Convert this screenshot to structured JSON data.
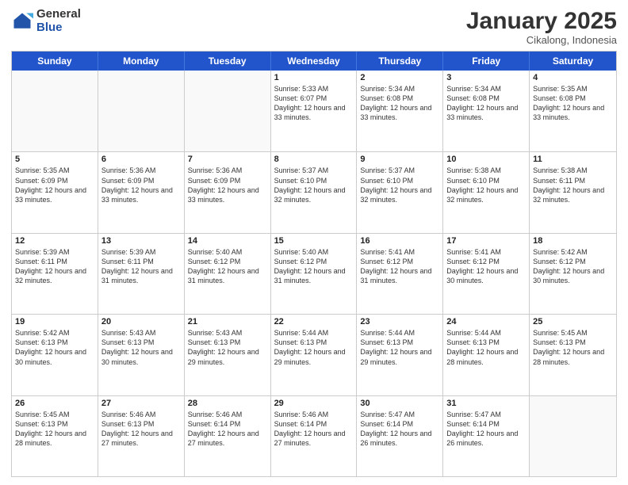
{
  "logo": {
    "general": "General",
    "blue": "Blue"
  },
  "title": {
    "month": "January 2025",
    "location": "Cikalong, Indonesia"
  },
  "header_days": [
    "Sunday",
    "Monday",
    "Tuesday",
    "Wednesday",
    "Thursday",
    "Friday",
    "Saturday"
  ],
  "weeks": [
    [
      {
        "day": "",
        "info": ""
      },
      {
        "day": "",
        "info": ""
      },
      {
        "day": "",
        "info": ""
      },
      {
        "day": "1",
        "info": "Sunrise: 5:33 AM\nSunset: 6:07 PM\nDaylight: 12 hours and 33 minutes."
      },
      {
        "day": "2",
        "info": "Sunrise: 5:34 AM\nSunset: 6:08 PM\nDaylight: 12 hours and 33 minutes."
      },
      {
        "day": "3",
        "info": "Sunrise: 5:34 AM\nSunset: 6:08 PM\nDaylight: 12 hours and 33 minutes."
      },
      {
        "day": "4",
        "info": "Sunrise: 5:35 AM\nSunset: 6:08 PM\nDaylight: 12 hours and 33 minutes."
      }
    ],
    [
      {
        "day": "5",
        "info": "Sunrise: 5:35 AM\nSunset: 6:09 PM\nDaylight: 12 hours and 33 minutes."
      },
      {
        "day": "6",
        "info": "Sunrise: 5:36 AM\nSunset: 6:09 PM\nDaylight: 12 hours and 33 minutes."
      },
      {
        "day": "7",
        "info": "Sunrise: 5:36 AM\nSunset: 6:09 PM\nDaylight: 12 hours and 33 minutes."
      },
      {
        "day": "8",
        "info": "Sunrise: 5:37 AM\nSunset: 6:10 PM\nDaylight: 12 hours and 32 minutes."
      },
      {
        "day": "9",
        "info": "Sunrise: 5:37 AM\nSunset: 6:10 PM\nDaylight: 12 hours and 32 minutes."
      },
      {
        "day": "10",
        "info": "Sunrise: 5:38 AM\nSunset: 6:10 PM\nDaylight: 12 hours and 32 minutes."
      },
      {
        "day": "11",
        "info": "Sunrise: 5:38 AM\nSunset: 6:11 PM\nDaylight: 12 hours and 32 minutes."
      }
    ],
    [
      {
        "day": "12",
        "info": "Sunrise: 5:39 AM\nSunset: 6:11 PM\nDaylight: 12 hours and 32 minutes."
      },
      {
        "day": "13",
        "info": "Sunrise: 5:39 AM\nSunset: 6:11 PM\nDaylight: 12 hours and 31 minutes."
      },
      {
        "day": "14",
        "info": "Sunrise: 5:40 AM\nSunset: 6:12 PM\nDaylight: 12 hours and 31 minutes."
      },
      {
        "day": "15",
        "info": "Sunrise: 5:40 AM\nSunset: 6:12 PM\nDaylight: 12 hours and 31 minutes."
      },
      {
        "day": "16",
        "info": "Sunrise: 5:41 AM\nSunset: 6:12 PM\nDaylight: 12 hours and 31 minutes."
      },
      {
        "day": "17",
        "info": "Sunrise: 5:41 AM\nSunset: 6:12 PM\nDaylight: 12 hours and 30 minutes."
      },
      {
        "day": "18",
        "info": "Sunrise: 5:42 AM\nSunset: 6:12 PM\nDaylight: 12 hours and 30 minutes."
      }
    ],
    [
      {
        "day": "19",
        "info": "Sunrise: 5:42 AM\nSunset: 6:13 PM\nDaylight: 12 hours and 30 minutes."
      },
      {
        "day": "20",
        "info": "Sunrise: 5:43 AM\nSunset: 6:13 PM\nDaylight: 12 hours and 30 minutes."
      },
      {
        "day": "21",
        "info": "Sunrise: 5:43 AM\nSunset: 6:13 PM\nDaylight: 12 hours and 29 minutes."
      },
      {
        "day": "22",
        "info": "Sunrise: 5:44 AM\nSunset: 6:13 PM\nDaylight: 12 hours and 29 minutes."
      },
      {
        "day": "23",
        "info": "Sunrise: 5:44 AM\nSunset: 6:13 PM\nDaylight: 12 hours and 29 minutes."
      },
      {
        "day": "24",
        "info": "Sunrise: 5:44 AM\nSunset: 6:13 PM\nDaylight: 12 hours and 28 minutes."
      },
      {
        "day": "25",
        "info": "Sunrise: 5:45 AM\nSunset: 6:13 PM\nDaylight: 12 hours and 28 minutes."
      }
    ],
    [
      {
        "day": "26",
        "info": "Sunrise: 5:45 AM\nSunset: 6:13 PM\nDaylight: 12 hours and 28 minutes."
      },
      {
        "day": "27",
        "info": "Sunrise: 5:46 AM\nSunset: 6:13 PM\nDaylight: 12 hours and 27 minutes."
      },
      {
        "day": "28",
        "info": "Sunrise: 5:46 AM\nSunset: 6:14 PM\nDaylight: 12 hours and 27 minutes."
      },
      {
        "day": "29",
        "info": "Sunrise: 5:46 AM\nSunset: 6:14 PM\nDaylight: 12 hours and 27 minutes."
      },
      {
        "day": "30",
        "info": "Sunrise: 5:47 AM\nSunset: 6:14 PM\nDaylight: 12 hours and 26 minutes."
      },
      {
        "day": "31",
        "info": "Sunrise: 5:47 AM\nSunset: 6:14 PM\nDaylight: 12 hours and 26 minutes."
      },
      {
        "day": "",
        "info": ""
      }
    ]
  ]
}
